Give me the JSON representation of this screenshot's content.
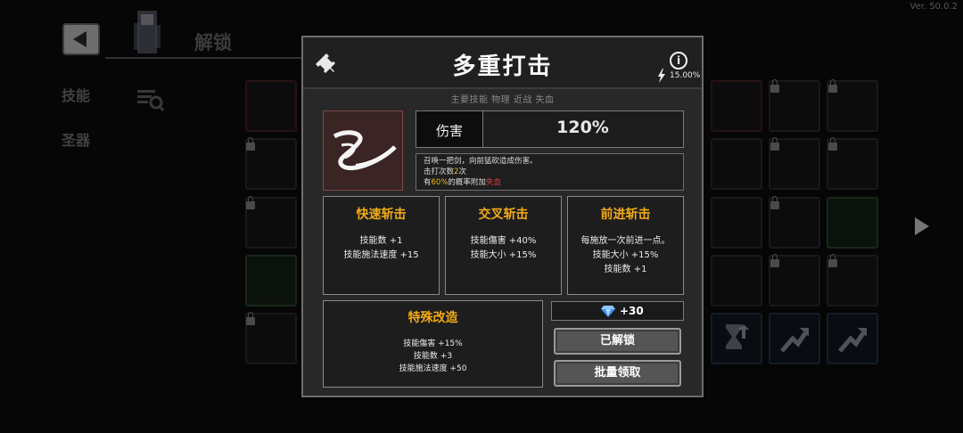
{
  "version": "Ver. 50.0.2",
  "background": {
    "title": "解锁",
    "tabs": [
      {
        "label": "技能"
      },
      {
        "label": "圣器"
      }
    ]
  },
  "modal": {
    "title": "多重打击",
    "cooldown_pct": "15.00%",
    "tags": "主要技能  物理  近战  失血",
    "damage": {
      "label": "伤害",
      "value": "120%"
    },
    "description": {
      "line1": "召唤一把剑，向前猛砍造成伤害。",
      "line2_prefix": "击打次数",
      "line2_value": "2",
      "line2_suffix": "次",
      "line3_prefix": "有",
      "line3_value": "60%",
      "line3_mid": "的概率附加",
      "line3_effect": "失血"
    },
    "upgrades": [
      {
        "title": "快速斩击",
        "lines": [
          "技能数 +1",
          "技能施法速度 +15"
        ]
      },
      {
        "title": "交叉斩击",
        "lines": [
          "技能傷害 +40%",
          "技能大小 +15%"
        ]
      },
      {
        "title": "前进斩击",
        "lines": [
          "每施放一次前进一点。",
          "技能大小 +15%",
          "技能数 +1"
        ]
      }
    ],
    "special": {
      "title": "特殊改造",
      "lines": [
        "技能傷害 +15%",
        "技能数 +3",
        "技能施法速度 +50"
      ]
    },
    "gem_reward": "+30",
    "unlocked_label": "已解锁",
    "bulk_claim_label": "批量领取"
  },
  "colors": {
    "accent": "#f2ab1b",
    "highlight_yellow": "#f2b81d",
    "highlight_red": "#e33b3b"
  }
}
